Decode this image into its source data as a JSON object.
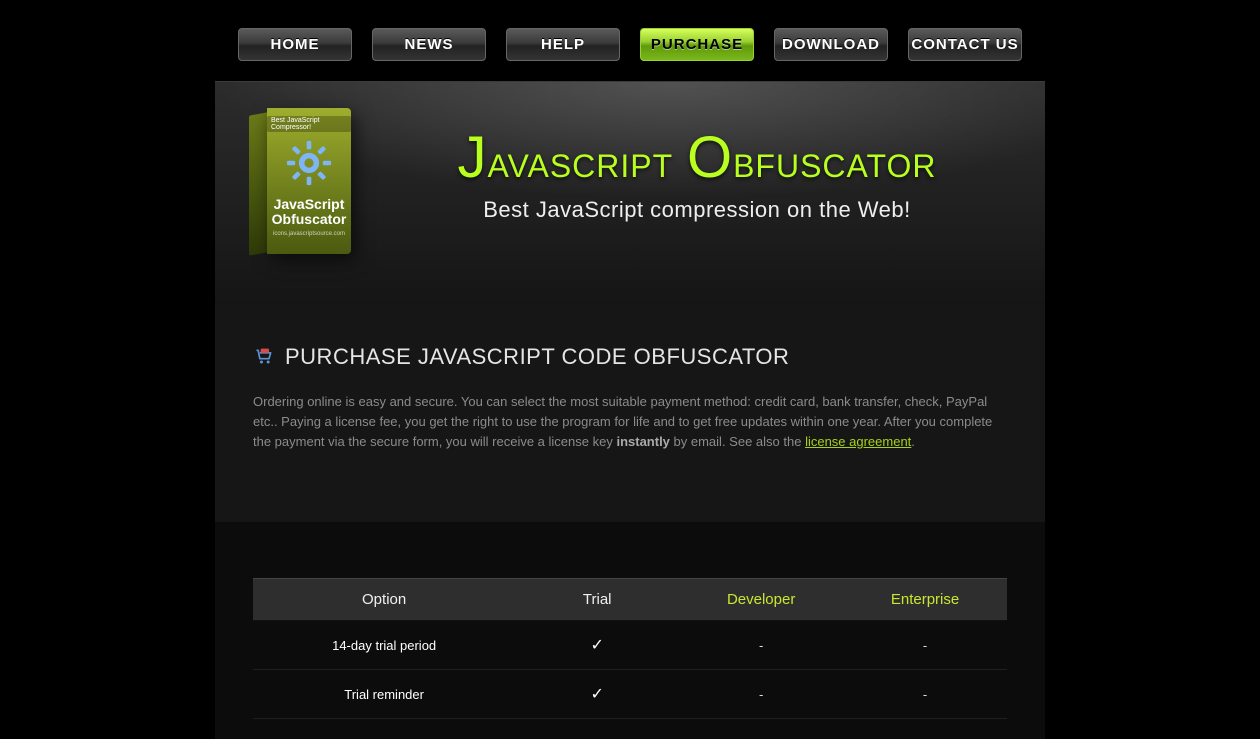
{
  "nav": {
    "items": [
      {
        "label": "HOME",
        "active": false
      },
      {
        "label": "NEWS",
        "active": false
      },
      {
        "label": "HELP",
        "active": false
      },
      {
        "label": "PURCHASE",
        "active": true
      },
      {
        "label": "DOWNLOAD",
        "active": false
      },
      {
        "label": "CONTACT US",
        "active": false
      }
    ]
  },
  "hero": {
    "title_cap1": "J",
    "title_part1": "avascript ",
    "title_cap2": "O",
    "title_part2": "bfuscator",
    "tagline": "Best JavaScript compression on the Web!",
    "box": {
      "banner": "Best JavaScript Compressor!",
      "label_line1": "JavaScript",
      "label_line2": "Obfuscator",
      "sub": "icons.javascriptsource.com"
    }
  },
  "section": {
    "heading": "PURCHASE JAVASCRIPT CODE OBFUSCATOR",
    "intro_1": "Ordering online is easy and secure. You can select the most suitable payment method: credit card, bank transfer, check, PayPal etc.. Paying a license fee, you get the right to use the program for life and to get free updates within one year. After you complete the payment via the secure form, you will receive a license key ",
    "intro_instant": "instantly",
    "intro_2": " by email. See also the ",
    "license_link": "license agreement",
    "intro_3": "."
  },
  "table": {
    "columns": [
      "Option",
      "Trial",
      "Developer",
      "Enterprise"
    ],
    "rows": [
      {
        "label": "14-day trial period",
        "trial": "✓",
        "developer": "-",
        "enterprise": "-"
      },
      {
        "label": "Trial reminder",
        "trial": "✓",
        "developer": "-",
        "enterprise": "-"
      }
    ]
  }
}
